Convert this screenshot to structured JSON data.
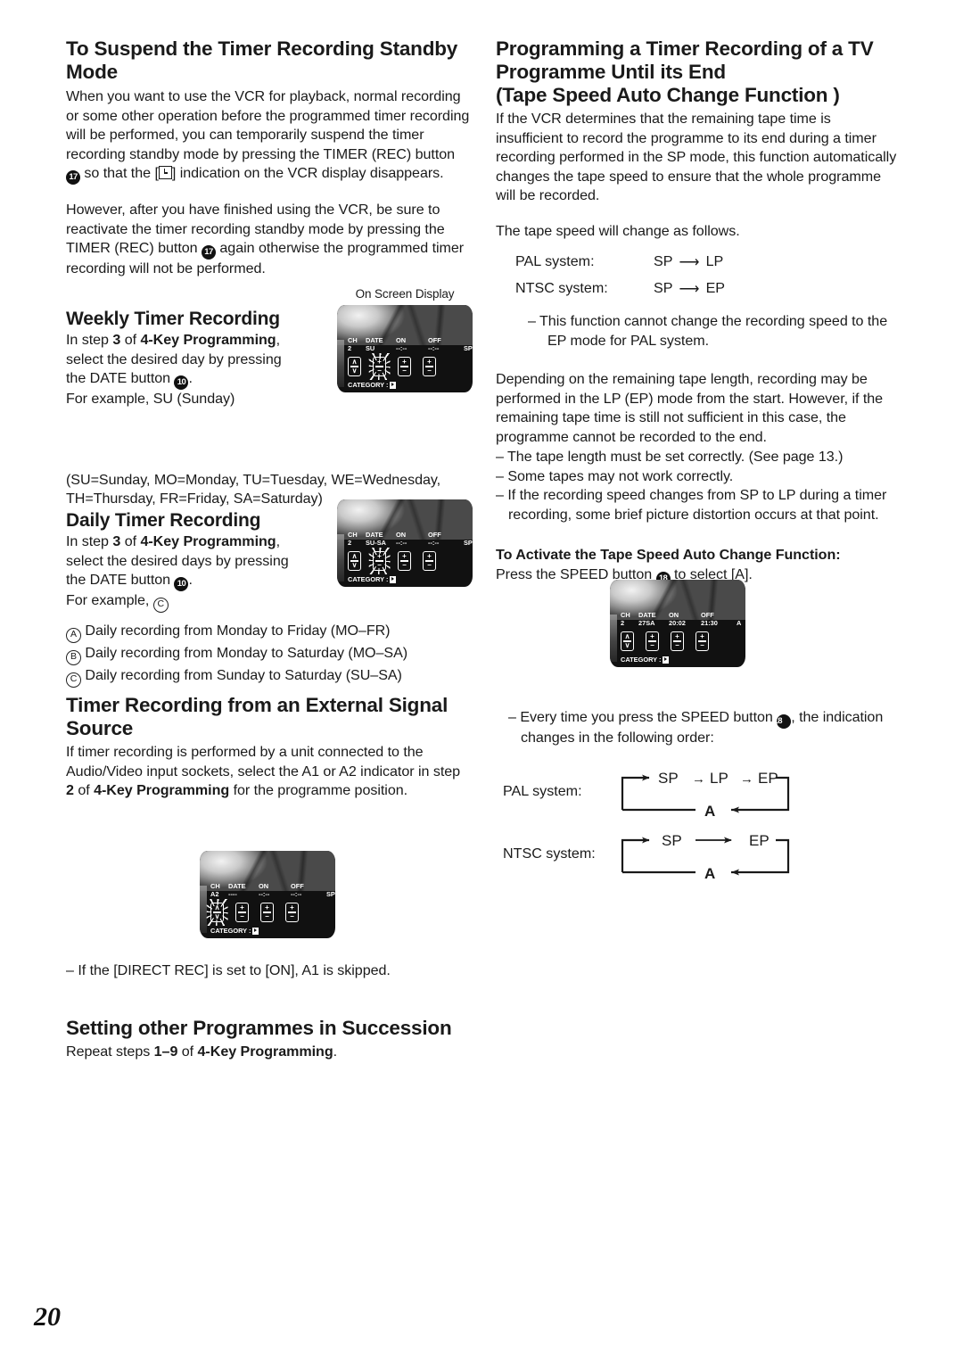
{
  "page": {
    "number": "20"
  },
  "left": {
    "section1": {
      "heading": "To Suspend the Timer Recording Standby Mode",
      "para1_a": "When you want to use the VCR for playback, normal recording or some other operation before the programmed timer recording will be performed, you can temporarily suspend the timer recording standby mode by pressing the TIMER (REC) button ",
      "btn1": "17",
      "para1_b": " so that the [",
      "para1_c": "] indication on the VCR display disappears.",
      "para2_a": "However, after you have finished using the VCR, be sure to reactivate the timer recording standby mode by pressing the TIMER (REC) button ",
      "btn2": "17",
      "para2_b": " again otherwise the programmed timer recording will not be performed."
    },
    "weekly": {
      "heading": "Weekly Timer Recording",
      "line1_a": "In step ",
      "line1_step": "3",
      "line1_b": " of ",
      "line1_prog": "4-Key Programming",
      "line1_c": ",",
      "line2": "select the desired day by pressing",
      "line3_a": "the DATE button ",
      "line3_btn": "10",
      "line3_b": ".",
      "line4": "For example, SU (Sunday)",
      "osd_caption": "On Screen Display",
      "days": "(SU=Sunday, MO=Monday, TU=Tuesday, WE=Wednesday, TH=Thursday, FR=Friday, SA=Saturday)"
    },
    "daily": {
      "heading": "Daily Timer Recording",
      "line1_a": "In step ",
      "line1_step": "3",
      "line1_b": " of ",
      "line1_prog": "4-Key Programming",
      "line1_c": ",",
      "line2": "select the desired days by pressing",
      "line3_a": "the DATE button ",
      "line3_btn": "10",
      "line3_b": ".",
      "line4_a": "For example, ",
      "line4_c": "C",
      "options": [
        {
          "marker": "A",
          "text": "Daily recording from Monday to Friday (MO–FR)"
        },
        {
          "marker": "B",
          "text": "Daily recording from Monday to Saturday (MO–SA)"
        },
        {
          "marker": "C",
          "text": "Daily recording from Sunday to Saturday (SU–SA)"
        }
      ]
    },
    "external": {
      "heading": "Timer Recording from an External Signal Source",
      "para_a": "If timer recording is performed by a unit connected to the Audio/Video input sockets, select the A1 or A2 indicator in step ",
      "para_step": "2",
      "para_b": " of ",
      "para_prog": "4-Key Programming",
      "para_c": " for the programme position.",
      "note": "– If the [DIRECT REC] is set to [ON], A1 is skipped."
    },
    "succession": {
      "heading": "Setting other Programmes in Succession",
      "line_a": "Repeat steps ",
      "line_steps": "1–9",
      "line_b": " of ",
      "line_prog": "4-Key Programming",
      "line_c": "."
    }
  },
  "right": {
    "heading_l1": "Programming a Timer Recording of a TV",
    "heading_l2": "Programme Until its End",
    "heading_l3": "(Tape Speed Auto Change Function )",
    "para1": "If the VCR determines that the remaining tape time is insufficient to record the programme to its end during a timer recording performed in the SP mode, this function automatically changes the tape speed to ensure that the whole programme will be recorded.",
    "para2": "The tape speed will change as follows.",
    "speed_rows": [
      {
        "label": "PAL system:",
        "from": "SP",
        "to": "LP"
      },
      {
        "label": "NTSC system:",
        "from": "SP",
        "to": "EP"
      }
    ],
    "note1": "– This function cannot change the recording speed to the EP mode for PAL system.",
    "para3": "Depending on the remaining tape length, recording may be performed in the LP (EP) mode from the start. However, if the remaining tape time is still not sufficient in this case, the programme cannot be recorded to the end.",
    "bullets": [
      "– The tape length must be set correctly. (See page 13.)",
      "– Some tapes may not work correctly.",
      "– If the recording speed changes from SP to LP during a timer recording, some brief picture distortion occurs at that point."
    ],
    "activate": {
      "heading": "To Activate the Tape Speed Auto Change Function:",
      "line_a": "Press the SPEED button ",
      "btn": "18",
      "line_b": " to select [A]."
    },
    "cycle_note_a": "– Every time you press the SPEED button ",
    "cycle_note_btn": "18",
    "cycle_note_b": ", the indication changes in the following order:",
    "cycles": [
      {
        "label": "PAL system:",
        "items": [
          "SP",
          "LP",
          "EP"
        ],
        "return": "A"
      },
      {
        "label": "NTSC system:",
        "items": [
          "SP",
          "EP"
        ],
        "return": "A"
      }
    ]
  },
  "osd_screens": [
    {
      "id": "weekly",
      "headers": [
        "CH",
        "DATE",
        "ON",
        "OFF"
      ],
      "values": {
        "ch": "2",
        "date": "SU",
        "on": "--:--",
        "off": "--:--",
        "speed": "SP"
      },
      "blink_key_index": 1,
      "keys": [
        "updown",
        "plusminus",
        "plusminus",
        "plusminus"
      ],
      "category_label": "CATEGORY :"
    },
    {
      "id": "daily",
      "headers": [
        "CH",
        "DATE",
        "ON",
        "OFF"
      ],
      "values": {
        "ch": "2",
        "date": "SU-SA",
        "on": "--:--",
        "off": "--:--",
        "speed": "SP"
      },
      "blink_key_index": 1,
      "keys": [
        "updown",
        "plusminus",
        "plusminus",
        "plusminus"
      ],
      "category_label": "CATEGORY :"
    },
    {
      "id": "external",
      "headers": [
        "CH",
        "DATE",
        "ON",
        "OFF"
      ],
      "values": {
        "ch": "A2",
        "date": "----",
        "on": "--:--",
        "off": "--:--",
        "speed": "SP"
      },
      "blink_key_index": 0,
      "keys": [
        "updown",
        "plusminus",
        "plusminus",
        "plusminus"
      ],
      "category_label": "CATEGORY :"
    },
    {
      "id": "autospeed",
      "headers": [
        "CH",
        "DATE",
        "ON",
        "OFF"
      ],
      "values": {
        "ch": "2",
        "date": "27SA",
        "on": "20:02",
        "off": "21:30",
        "speed": "A"
      },
      "blink_key_index": -1,
      "keys": [
        "updown",
        "plusminus",
        "plusminus",
        "plusminus"
      ],
      "category_label": "CATEGORY :"
    }
  ]
}
